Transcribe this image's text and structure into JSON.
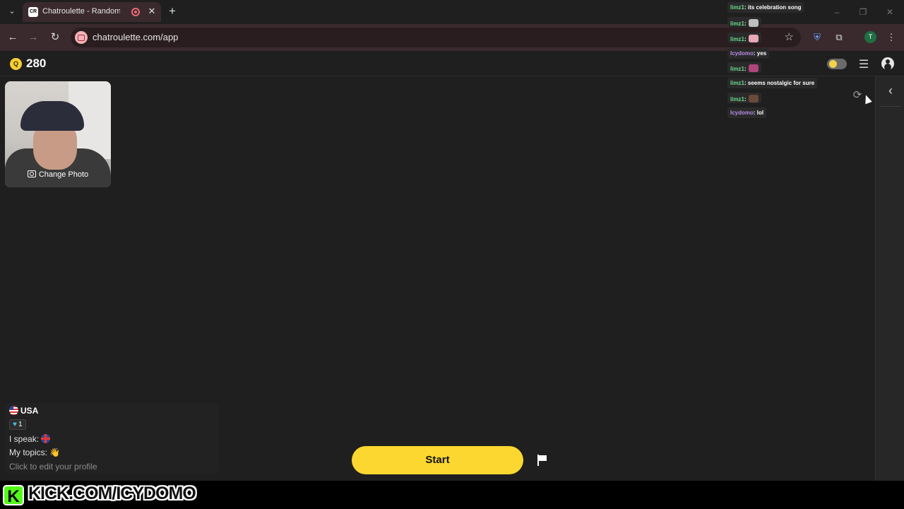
{
  "browser": {
    "tab_title": "Chatroulette - Random vide",
    "tab_favicon_text": "CR",
    "url": "chatroulette.com/app",
    "profile_initial": "T",
    "icons": [
      "tab-menu-icon",
      "close-icon",
      "plus-icon",
      "back-icon",
      "forward-icon",
      "reload-icon",
      "star-icon",
      "shield-extension-icon",
      "puzzle-extension-icon",
      "more-vert-icon",
      "minimize-icon",
      "restore-icon",
      "window-close-icon"
    ]
  },
  "app": {
    "coins": "280",
    "coin_symbol": "Q",
    "change_photo_label": "Change Photo",
    "start_label": "Start",
    "profile": {
      "country": "USA",
      "rank": "1",
      "speak_label": "I speak:",
      "topics_label": "My topics: 👋",
      "edit_hint": "Click to edit your profile"
    }
  },
  "chat_overlay": [
    {
      "name": "limz1",
      "text": ": its celebration song",
      "emote": null
    },
    {
      "name": "limz1",
      "text": ":",
      "emote": "#bfbfbf"
    },
    {
      "name": "limz1",
      "text": ":",
      "emote": "#e8a7b5"
    },
    {
      "name": "Icydomo",
      "text": ": yes",
      "emote": null
    },
    {
      "name": "limz1",
      "text": ":",
      "emote": "#b0457a"
    },
    {
      "name": "limz1",
      "text": ": seems nostalgic for sure",
      "emote": null
    },
    {
      "name": "limz1",
      "text": ":",
      "emote": "#6a4a3a"
    },
    {
      "name": "Icydomo",
      "text": ": lol",
      "emote": null
    }
  ],
  "watermark": {
    "logo_letter": "K",
    "url": "KICK.COM/ICYDOMO"
  },
  "colors": {
    "accent": "#fbd730",
    "background": "#1f1f1f",
    "browser_frame": "#3a2a2d",
    "kick_green": "#53fc18"
  }
}
